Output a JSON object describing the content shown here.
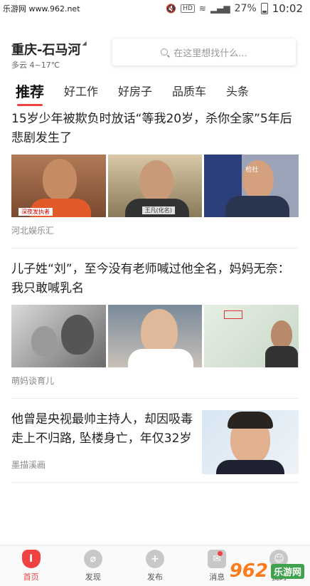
{
  "watermark_top": "乐游网 www.962.net",
  "status": {
    "battery": "27%",
    "time": "10:02",
    "hd": "HD"
  },
  "location": {
    "city": "重庆-石马河",
    "weather": "多云 4~17℃"
  },
  "search": {
    "placeholder": "在这里想找什么..."
  },
  "tabs": [
    "推荐",
    "好工作",
    "好房子",
    "品质车",
    "头条"
  ],
  "articles": [
    {
      "title": "15岁少年被欺负时放话“等我20岁，杀你全家”5年后悲剧发生了",
      "source": "河北娱乐汇",
      "captions": [
        "深夜发执者",
        "王凡(化名)",
        "检社"
      ]
    },
    {
      "title": "儿子姓“刘”，至今没有老师喊过他全名，妈妈无奈：我只敢喊乳名",
      "source": "萌妈谈育儿"
    },
    {
      "title": "他曾是央视最帅主持人，却因吸毒走上不归路, 坠楼身亡，年仅32岁",
      "source": "墨描溪画"
    }
  ],
  "nav": [
    {
      "label": "首页",
      "icon": "home-icon",
      "glyph": "I"
    },
    {
      "label": "发现",
      "icon": "compass-icon",
      "glyph": "⌀"
    },
    {
      "label": "发布",
      "icon": "plus-icon",
      "glyph": "+"
    },
    {
      "label": "消息",
      "icon": "message-icon",
      "glyph": "✉"
    },
    {
      "label": "我的",
      "icon": "profile-icon",
      "glyph": "☺"
    }
  ],
  "watermark_bottom": {
    "logo": "962",
    "text": "乐游网"
  },
  "colors": {
    "accent": "#f04142"
  }
}
